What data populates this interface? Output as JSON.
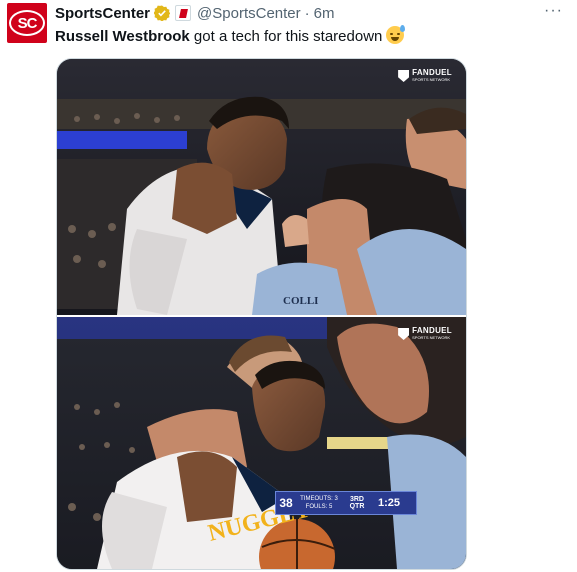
{
  "tweet": {
    "account_name": "SportsCenter",
    "handle": "@SportsCenter",
    "separator": "·",
    "time": "6m",
    "more_label": "···",
    "avatar_text": "SC",
    "text_bold": "Russell Westbrook",
    "text_rest": " got a tech for this staredown",
    "emoji_name": "sweat-smile-emoji"
  },
  "media": {
    "top": {
      "watermark_brand": "FANDUEL",
      "watermark_sub": "SPORTS NETWORK",
      "jersey_back_text": "COLLI"
    },
    "bottom": {
      "watermark_brand": "FANDUEL",
      "watermark_sub": "SPORTS NETWORK",
      "jersey_text": "NUGGETS",
      "scorebug": {
        "score": "38",
        "timeouts": "TIMEOUTS: 3",
        "fouls": "FOULS: 5",
        "quarter": "3RD QTR",
        "clock": "1:25"
      }
    }
  },
  "colors": {
    "brand_red": "#d0021b",
    "verified_gold": "#e2b719",
    "text_primary": "#0f1419",
    "text_secondary": "#536471"
  }
}
